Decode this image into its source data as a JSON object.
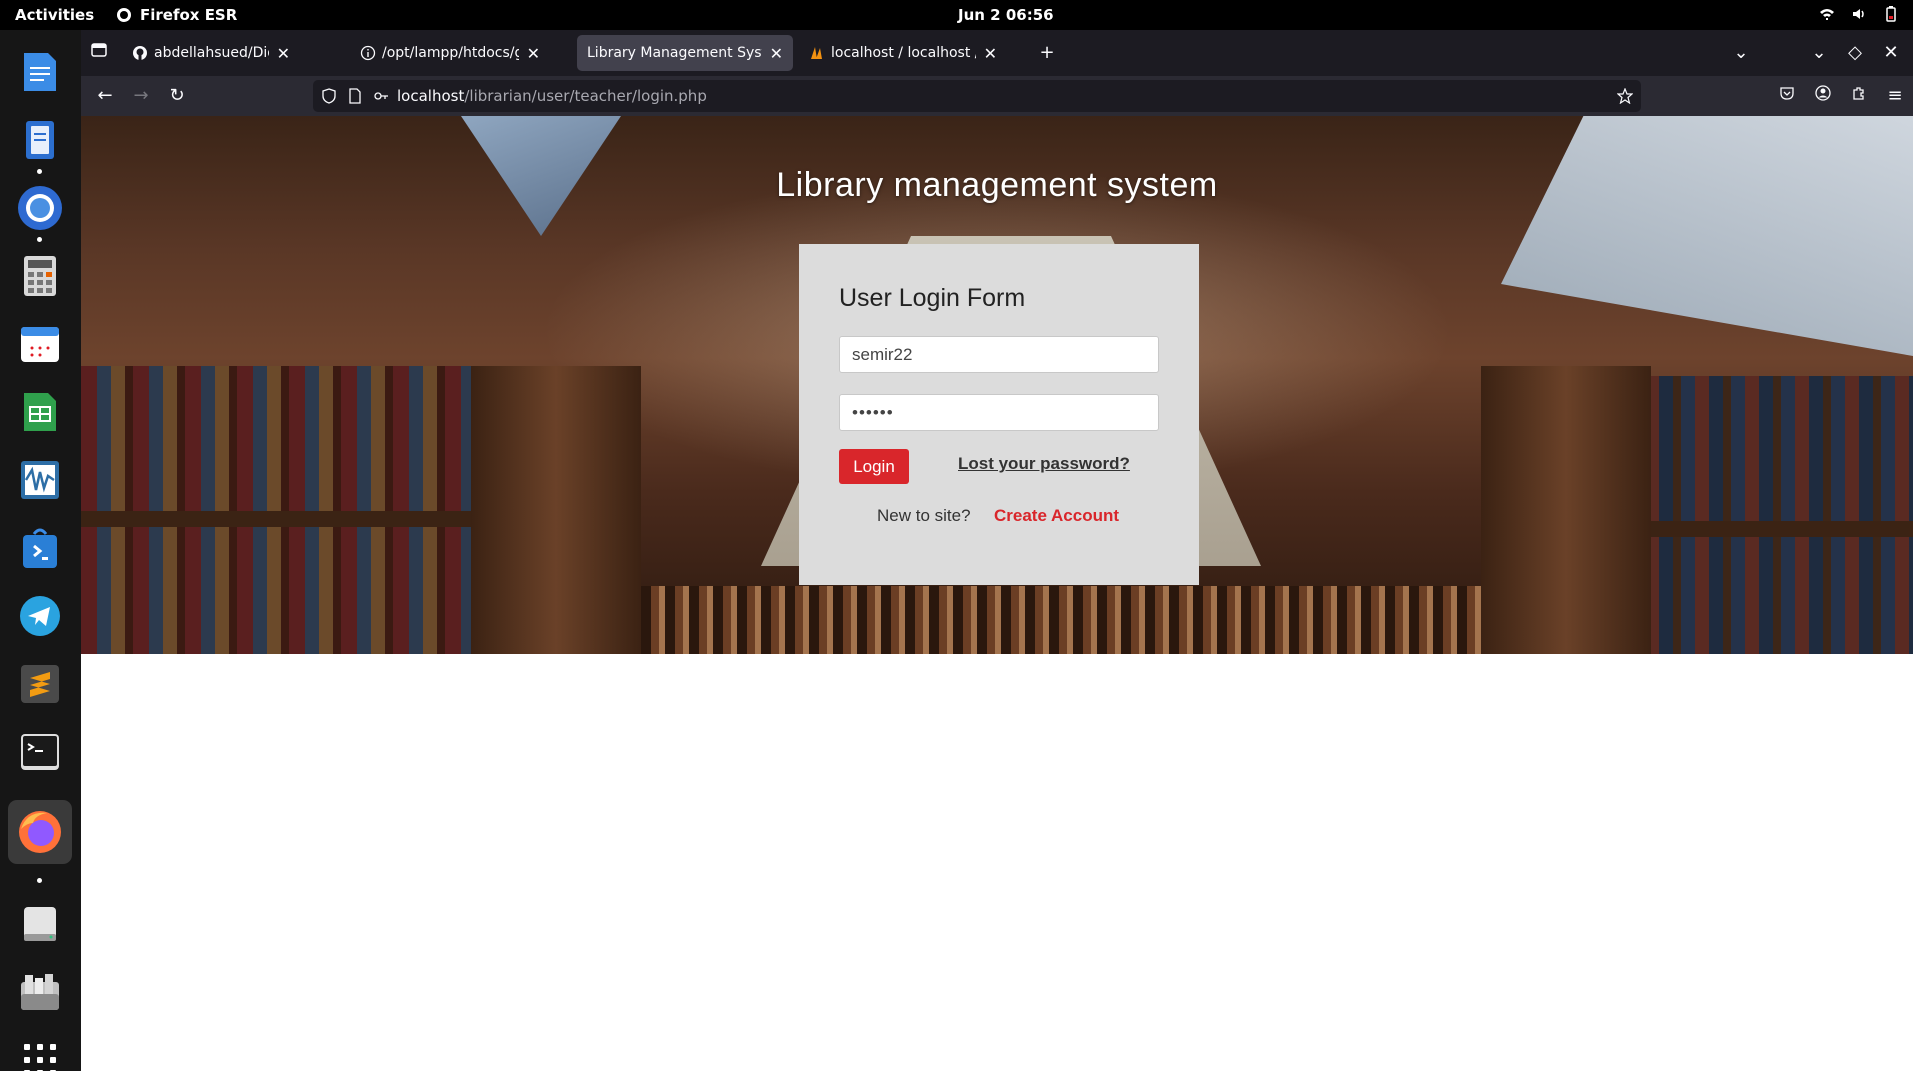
{
  "system": {
    "activities": "Activities",
    "app_name": "Firefox ESR",
    "clock": "Jun 2  06:56"
  },
  "dock": {
    "items": [
      {
        "name": "text-editor-icon",
        "color": "#3b8ce6"
      },
      {
        "name": "document-viewer-icon",
        "color": "#3b8ce6"
      },
      {
        "name": "chromium-icon",
        "color": "#4a90e2"
      },
      {
        "name": "calculator-icon",
        "color": "#888888"
      },
      {
        "name": "calendar-icon",
        "color": "#ffffff"
      },
      {
        "name": "spreadsheet-icon",
        "color": "#2fa04c"
      },
      {
        "name": "waveform-icon",
        "color": "#2d6ea6"
      },
      {
        "name": "software-store-icon",
        "color": "#3b8ce6"
      },
      {
        "name": "telegram-icon",
        "color": "#2aa3e0"
      },
      {
        "name": "sublime-text-icon",
        "color": "#f39c12"
      },
      {
        "name": "terminal-icon",
        "color": "#333333"
      },
      {
        "name": "firefox-icon",
        "color": "#ff7139"
      },
      {
        "name": "drive-icon",
        "color": "#dddddd"
      },
      {
        "name": "archive-icon",
        "color": "#aaaaaa"
      },
      {
        "name": "app-grid-icon",
        "color": "#ffffff"
      }
    ]
  },
  "browser": {
    "tabs": [
      {
        "label": "abdellahsued/Digitallibrary",
        "icon": "github-icon"
      },
      {
        "label": "/opt/lampp/htdocs/github",
        "icon": "info-icon"
      },
      {
        "label": "Library Management System",
        "icon": ""
      },
      {
        "label": "localhost / localhost / proje",
        "icon": "phpmyadmin-icon"
      }
    ],
    "url_host": "localhost",
    "url_path": "/librarian/user/teacher/login.php"
  },
  "page": {
    "title": "Library management system",
    "form": {
      "heading": "User Login Form",
      "username_value": "semir22",
      "password_value": "••••••",
      "login_label": "Login",
      "lost_password": "Lost your password?",
      "new_to_site": "New to site?",
      "create_account": "Create Account"
    }
  },
  "colors": {
    "accent": "#d9262b",
    "card_bg": "#dcdcdc",
    "browser_chrome": "#2b2a33"
  }
}
